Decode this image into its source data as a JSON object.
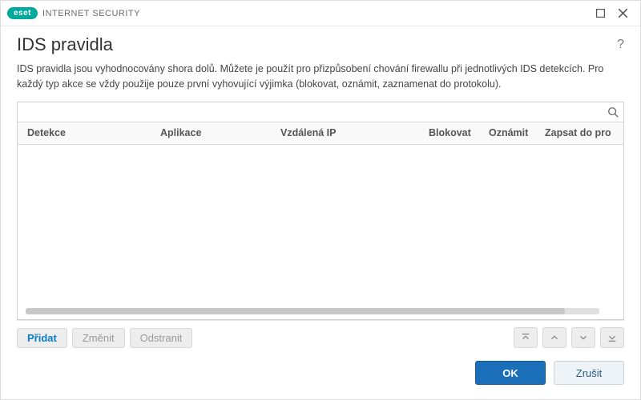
{
  "brand": {
    "logo": "eset",
    "product": "INTERNET SECURITY"
  },
  "page": {
    "title": "IDS pravidla",
    "description": "IDS pravidla jsou vyhodnocovány shora dolů. Můžete je použít pro přizpůsobení chování firewallu při jednotlivých IDS detekcích. Pro každý typ akce se vždy použije pouze první vyhovující výjimka (blokovat, oznámit, zaznamenat do protokolu)."
  },
  "search": {
    "placeholder": ""
  },
  "columns": {
    "detection": "Detekce",
    "application": "Aplikace",
    "remote_ip": "Vzdálená IP",
    "block": "Blokovat",
    "notify": "Oznámit",
    "log": "Zapsat do pro"
  },
  "rows": [],
  "actions": {
    "add": "Přidat",
    "edit": "Změnit",
    "remove": "Odstranit"
  },
  "footer": {
    "ok": "OK",
    "cancel": "Zrušit"
  }
}
